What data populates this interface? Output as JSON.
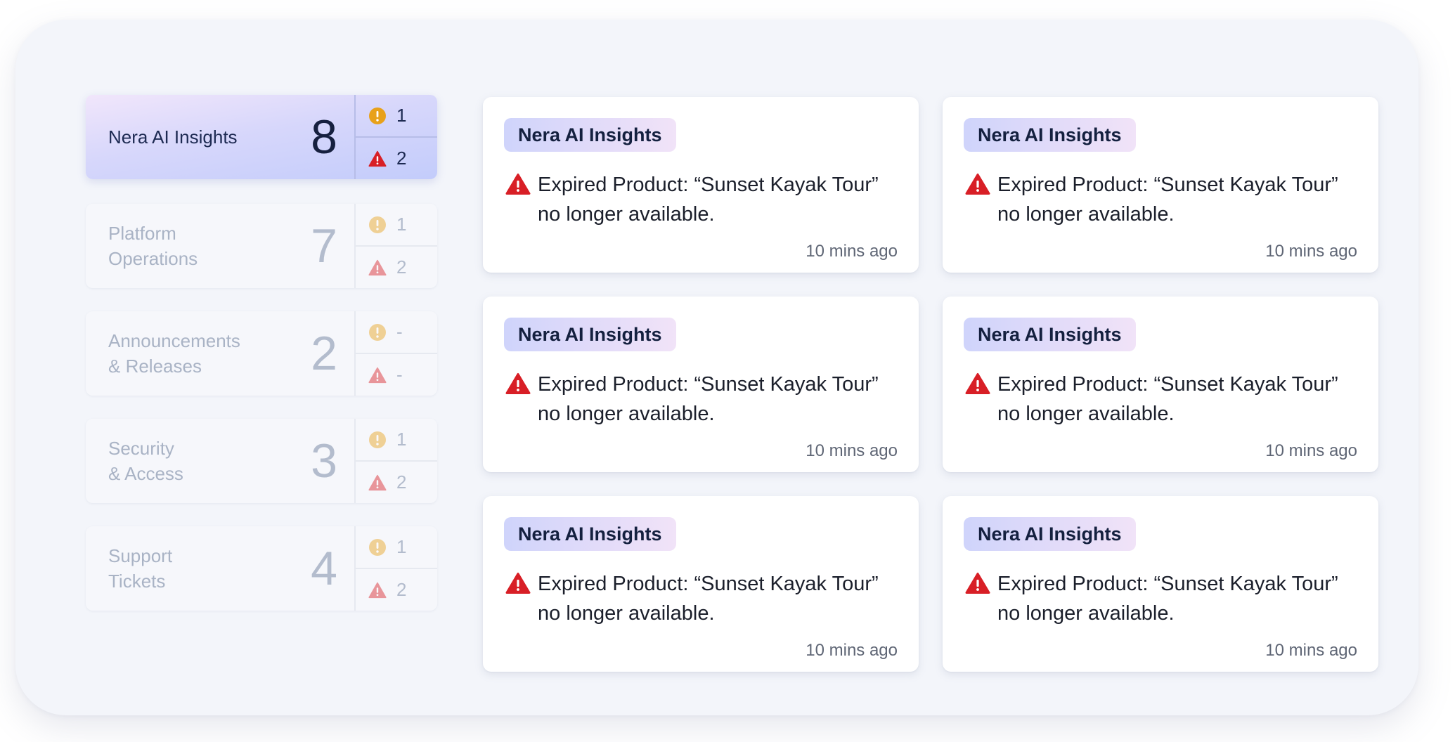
{
  "categories": [
    {
      "label": "Nera AI Insights",
      "count": "8",
      "warnings": "1",
      "errors": "2",
      "active": true
    },
    {
      "label": "Platform\nOperations",
      "count": "7",
      "warnings": "1",
      "errors": "2",
      "active": false
    },
    {
      "label": "Announcements\n& Releases",
      "count": "2",
      "warnings": "-",
      "errors": "-",
      "active": false
    },
    {
      "label": "Security\n& Access",
      "count": "3",
      "warnings": "1",
      "errors": "2",
      "active": false
    },
    {
      "label": "Support\nTickets",
      "count": "4",
      "warnings": "1",
      "errors": "2",
      "active": false
    }
  ],
  "cards": [
    {
      "tag": "Nera AI Insights",
      "message": "Expired Product: “Sunset Kayak Tour” no longer available.",
      "time": "10 mins ago"
    },
    {
      "tag": "Nera AI Insights",
      "message": "Expired Product: “Sunset Kayak Tour” no longer available.",
      "time": "10 mins ago"
    },
    {
      "tag": "Nera AI Insights",
      "message": "Expired Product: “Sunset Kayak Tour” no longer available.",
      "time": "10 mins ago"
    },
    {
      "tag": "Nera AI Insights",
      "message": "Expired Product: “Sunset Kayak Tour” no longer available.",
      "time": "10 mins ago"
    },
    {
      "tag": "Nera AI Insights",
      "message": "Expired Product: “Sunset Kayak Tour” no longer available.",
      "time": "10 mins ago"
    },
    {
      "tag": "Nera AI Insights",
      "message": "Expired Product: “Sunset Kayak Tour” no longer available.",
      "time": "10 mins ago"
    }
  ],
  "icons": {
    "warning": "warning-circle-icon",
    "error": "alert-triangle-icon"
  },
  "colors": {
    "warning": "#e8a11a",
    "error": "#d81f26",
    "accent": "#c3ccfb"
  }
}
